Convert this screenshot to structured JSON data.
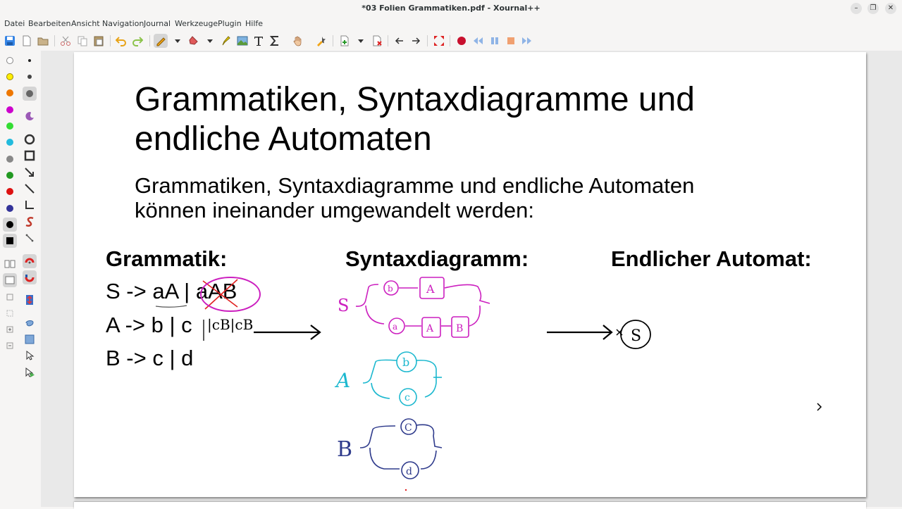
{
  "window": {
    "title": "*03 Folien Grammatiken.pdf - Xournal++",
    "minimize_glyph": "–",
    "maximize_glyph": "❐",
    "close_glyph": "✕"
  },
  "menu": [
    "Datei",
    "Bearbeiten",
    "Ansicht",
    "Navigation",
    "Journal",
    "Werkzeuge",
    "Plugin",
    "Hilfe"
  ],
  "toolbar_icons": [
    "save-icon",
    "new-icon",
    "open-icon",
    "cut-icon",
    "copy-icon",
    "paste-icon",
    "undo-icon",
    "redo-icon",
    "pen-icon",
    "eraser-icon",
    "highlighter-icon",
    "image-icon",
    "text-icon",
    "latex-icon",
    "hand-icon",
    "select-icon",
    "add-page-icon",
    "delete-page-icon",
    "previous-page-icon",
    "next-page-icon",
    "fullscreen-icon",
    "record-icon",
    "rewind-icon",
    "pause-icon",
    "stop-icon",
    "fast-forward-icon"
  ],
  "colors": {
    "palette": [
      "#ffffff",
      "#ffee00",
      "#ee7700",
      "#cc00cc",
      "#33dd33",
      "#22bbdd",
      "#888888",
      "#229922",
      "#dd1111",
      "#333399",
      "#000000"
    ],
    "ink_magenta": "#cc1fbf",
    "ink_cyan": "#1cb8cf",
    "ink_navy": "#2f3b8c",
    "ink_red": "#e02020",
    "accent": "#3584e4"
  },
  "slide": {
    "title_line1": "Grammatiken, Syntaxdiagramme und",
    "title_line2": "endliche Automaten",
    "sub_line1": "Grammatiken, Syntaxdiagramme und endliche Automaten",
    "sub_line2": "können ineinander umgewandelt werden:",
    "col1_heading": "Grammatik:",
    "col2_heading": "Syntaxdiagramm:",
    "col3_heading": "Endlicher Automat:",
    "rule1_lhs": "S -> ",
    "rule1_a": "aA",
    "rule1_sep": " | ",
    "rule1_b": "aAB",
    "rule2": "A -> b | c",
    "rule3": "B -> c | d"
  },
  "handwriting": {
    "rule2_addition": "|cB|cB",
    "s_symbol": "S",
    "a_symbol": "A",
    "b_symbol": "B",
    "node_b": "b",
    "node_A": "A",
    "node_a": "a",
    "node_B": "B",
    "node_c": "c",
    "node_d": "d",
    "node_C": "C",
    "state_label": "S"
  }
}
